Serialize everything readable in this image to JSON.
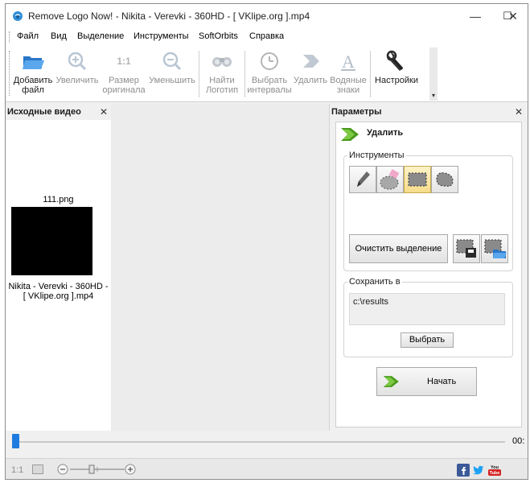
{
  "window": {
    "title": "Remove Logo Now! - Nikita - Verevki - 360HD - [ VKlipe.org ].mp4",
    "controls": {
      "minimize": "—",
      "maximize": "☐",
      "close": "✕"
    }
  },
  "menu": {
    "items": [
      {
        "label": "Файл"
      },
      {
        "label": "Вид"
      },
      {
        "label": "Выделение"
      },
      {
        "label": "Инструменты"
      },
      {
        "label": "SoftOrbits"
      },
      {
        "label": "Справка"
      }
    ]
  },
  "toolbar": {
    "add_file": {
      "line1": "Добавить",
      "line2": "файл"
    },
    "zoom_in": {
      "line1": "Увеличить",
      "line2": ""
    },
    "original_size": {
      "icon_text": "1:1",
      "line1": "Размер",
      "line2": "оригинала"
    },
    "zoom_out": {
      "line1": "Уменьшить",
      "line2": ""
    },
    "find_logo": {
      "line1": "Найти",
      "line2": "Логотип"
    },
    "select_intervals": {
      "line1": "Выбрать",
      "line2": "интервалы"
    },
    "remove": {
      "line1": "Удалить",
      "line2": ""
    },
    "watermarks": {
      "line1": "Водяные",
      "line2": "знаки"
    },
    "settings": {
      "line1": "Настройки",
      "line2": ""
    }
  },
  "left_panel": {
    "title": "Исходные видео",
    "close": "✕",
    "thumb_top_label": "111.png",
    "thumb_caption_line1": "Nikita - Verevki - 360HD -",
    "thumb_caption_line2": "[ VKlipe.org ].mp4"
  },
  "right_panel": {
    "title": "Параметры",
    "close": "✕",
    "section_title": "Удалить",
    "tools_group_title": "Инструменты",
    "clear_selection": "Очистить выделение",
    "save_group_title": "Сохранить в",
    "save_path": "c:\\results",
    "browse": "Выбрать",
    "start": "Начать"
  },
  "timeline": {
    "progress": 0,
    "time_label": "00:"
  },
  "status": {
    "ratio_label": "1:1",
    "zoom_level": 0.4
  },
  "icons": {
    "add_file": "folder-open-icon",
    "zoom_in": "magnifier-plus-icon",
    "zoom_out": "magnifier-minus-icon",
    "find_logo": "binoculars-icon",
    "select_intervals": "clock-icon",
    "remove": "arrow-right-icon",
    "watermarks": "letter-a-icon",
    "settings": "wrench-icon",
    "social": [
      "facebook-icon",
      "twitter-icon",
      "youtube-icon"
    ]
  },
  "colors": {
    "accent_green": "#4a9a1e",
    "timeline_handle": "#1e7be0",
    "active_tool": "#f6dc8a"
  }
}
